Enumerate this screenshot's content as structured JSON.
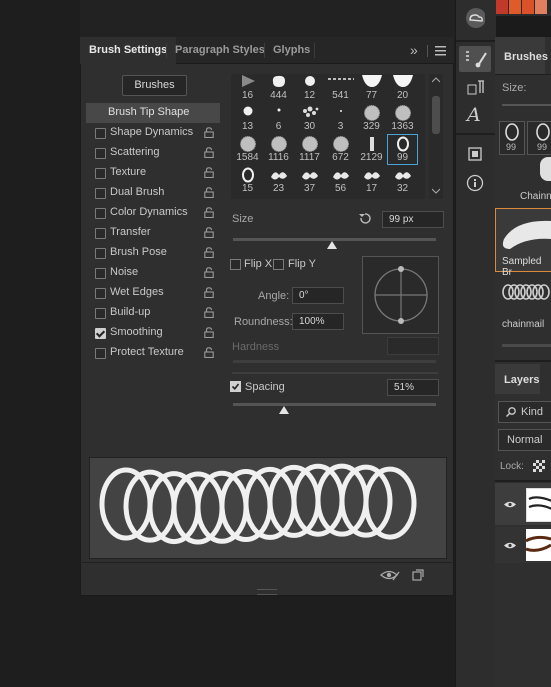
{
  "topbar": {
    "swatch_colors": [
      "#c0392b",
      "#e05a2a",
      "#d9522a",
      "#e08060"
    ]
  },
  "panel": {
    "tabs": [
      {
        "label": "Brush Settings",
        "active": true
      },
      {
        "label": "Paragraph Styles",
        "active": false
      },
      {
        "label": "Glyphs",
        "active": false
      }
    ],
    "overflow_label": "»",
    "brushes_button": "Brushes",
    "brush_tip_shape": "Brush Tip Shape",
    "options": [
      {
        "label": "Shape Dynamics",
        "checked": false
      },
      {
        "label": "Scattering",
        "checked": false
      },
      {
        "label": "Texture",
        "checked": false
      },
      {
        "label": "Dual Brush",
        "checked": false
      },
      {
        "label": "Color Dynamics",
        "checked": false
      },
      {
        "label": "Transfer",
        "checked": false
      },
      {
        "label": "Brush Pose",
        "checked": false
      },
      {
        "label": "Noise",
        "checked": false
      },
      {
        "label": "Wet Edges",
        "checked": false
      },
      {
        "label": "Build-up",
        "checked": false
      },
      {
        "label": "Smoothing",
        "checked": true
      },
      {
        "label": "Protect Texture",
        "checked": false
      }
    ],
    "brush_grid": [
      [
        "16",
        "444",
        "12",
        "541",
        "77",
        "20"
      ],
      [
        "13",
        "6",
        "30",
        "3",
        "329",
        "1363"
      ],
      [
        "1584",
        "1116",
        "1117",
        "672",
        "2129",
        "99"
      ],
      [
        "15",
        "23",
        "37",
        "56",
        "17",
        "32"
      ]
    ],
    "selected_brush": "99",
    "size_label": "Size",
    "size_value": "99 px",
    "flip_x": "Flip X",
    "flip_y": "Flip Y",
    "angle_label": "Angle:",
    "angle_value": "0°",
    "roundness_label": "Roundness:",
    "roundness_value": "100%",
    "hardness_label": "Hardness",
    "spacing_label": "Spacing",
    "spacing_checked": true,
    "spacing_value": "51%",
    "size_slider_fraction": 0.49,
    "spacing_slider_fraction": 0.25
  },
  "right_panel": {
    "brushes_tab": "Brushes",
    "size_label": "Size:",
    "brush_thumb_1": "99",
    "brush_thumb_2": "99",
    "item_chainmail_short": "Chainn",
    "item_sampled": "Sampled Br",
    "item_chainmail": "chainmail",
    "layers_tab": "Layers",
    "kind_label": "Kind",
    "blend_mode": "Normal",
    "lock_label": "Lock:"
  }
}
